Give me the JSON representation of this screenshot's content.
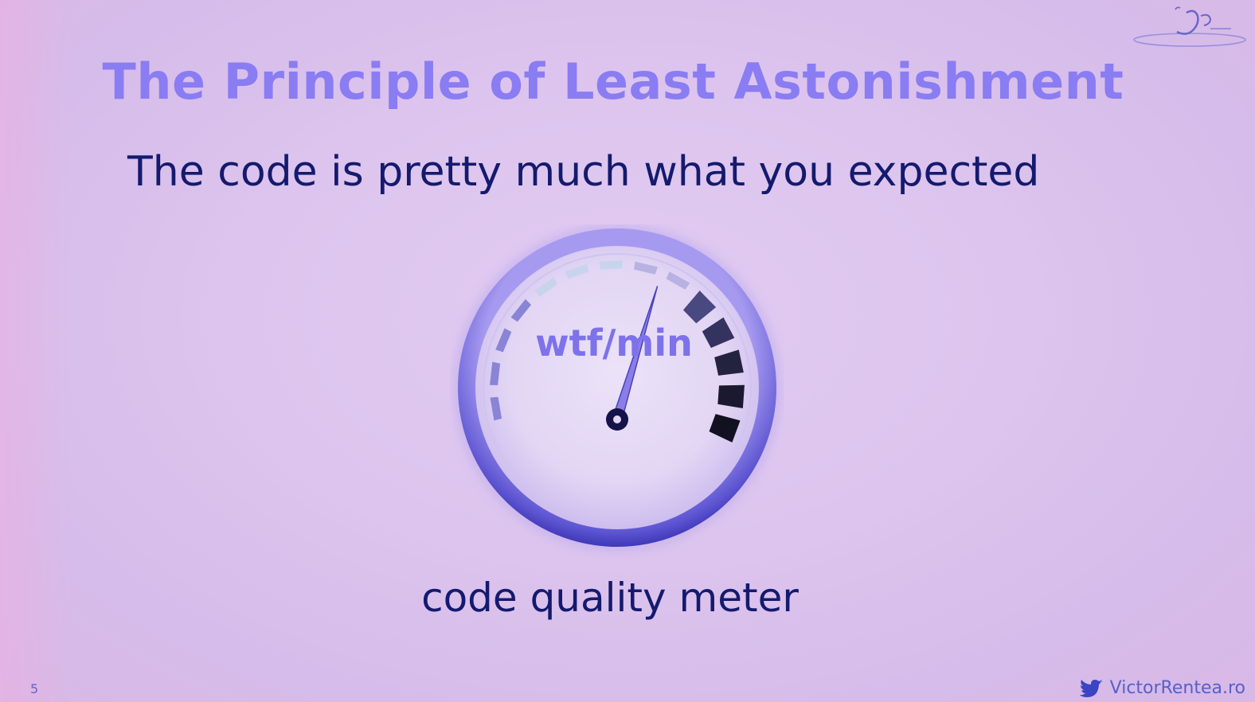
{
  "slide": {
    "title": "The Principle of Least Astonishment",
    "subtitle": "The code is pretty much what you expected",
    "caption": "code quality meter",
    "number": "5"
  },
  "gauge": {
    "label": "wtf/min",
    "needle_level": 0.58,
    "icon": "gauge-icon"
  },
  "footer": {
    "credit": "VictorRentea.ro",
    "icon": "twitter-bird-icon"
  },
  "logo": {
    "icon": "j-prime-logo-icon"
  },
  "colors": {
    "title": "#8a7cf2",
    "body_text": "#141a6e",
    "background": "#dcc4ee",
    "gauge_ring": "#6b63d8",
    "needle": "#8b7de8"
  }
}
